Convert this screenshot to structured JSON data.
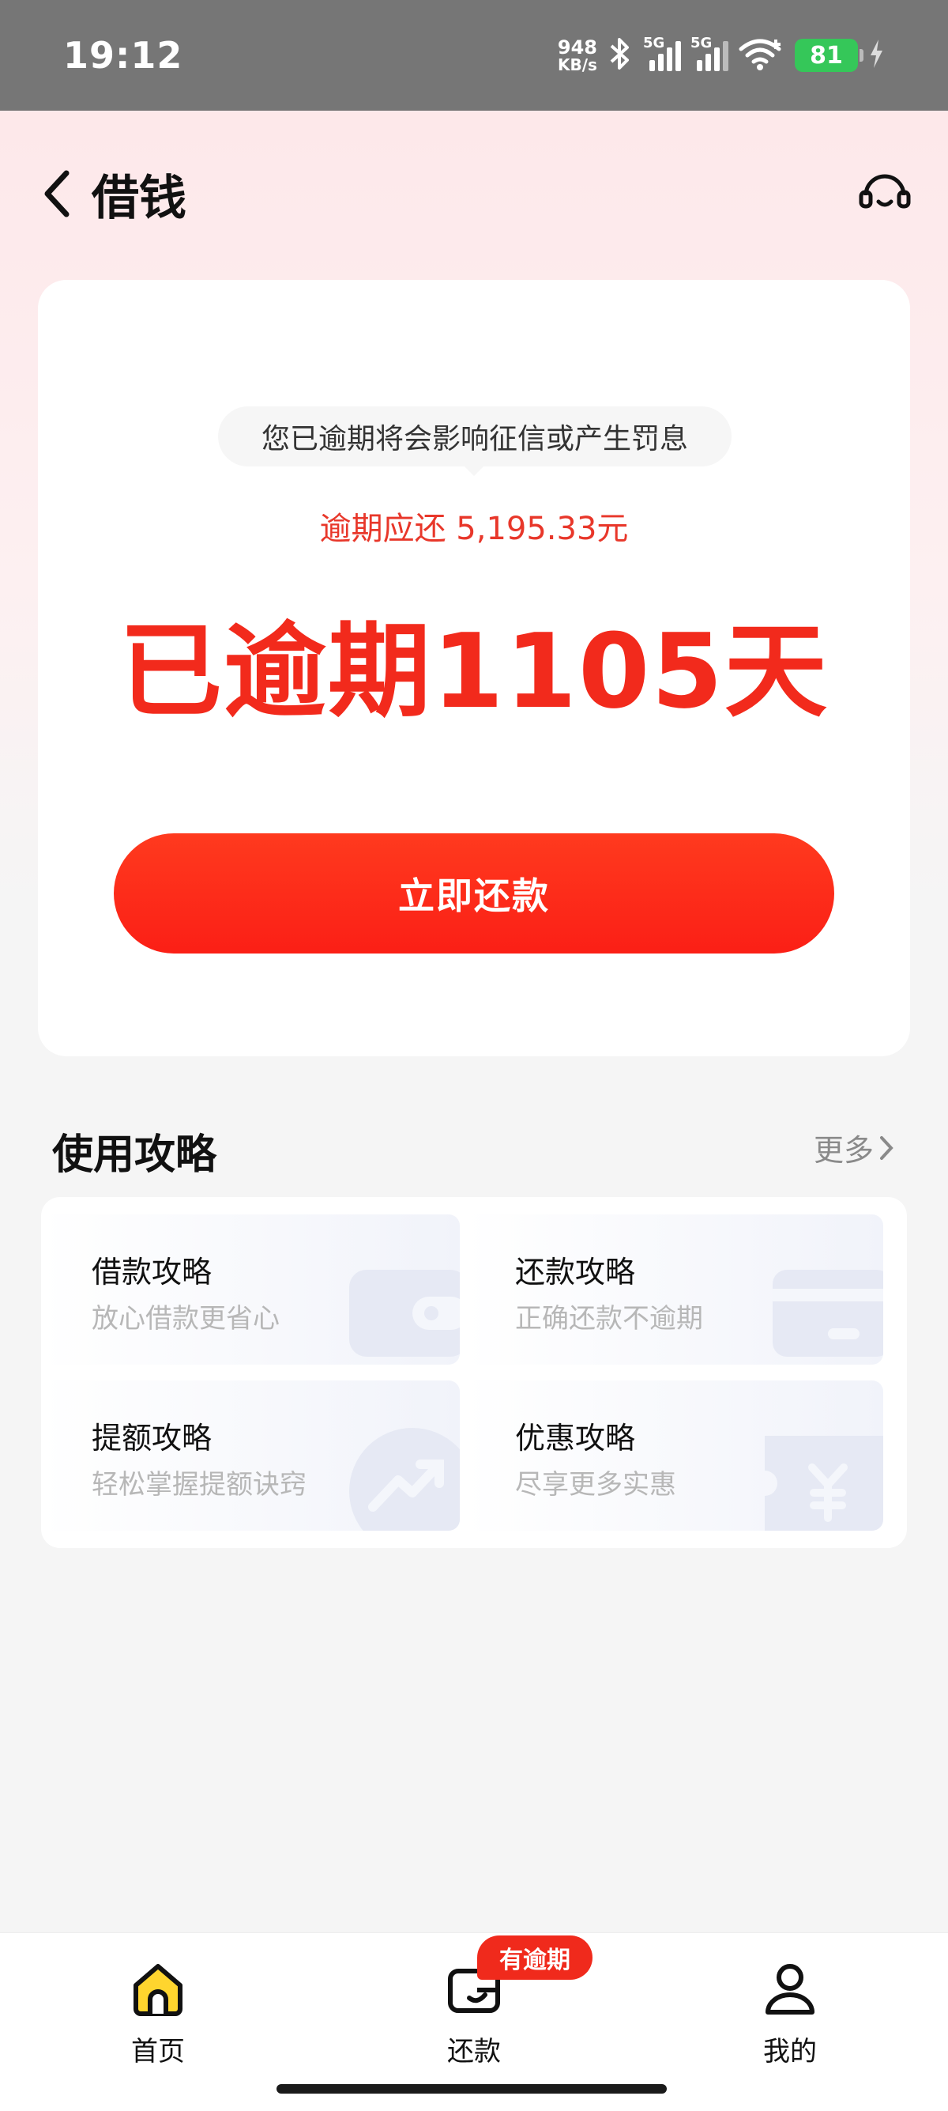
{
  "status_bar": {
    "time": "19:12",
    "net_speed_value": "948",
    "net_speed_unit": "KB/s",
    "sim1_label": "5G",
    "sim2_label": "5G",
    "battery_level": "81"
  },
  "header": {
    "title": "借钱"
  },
  "overdue_card": {
    "notice": "您已逾期将会影响征信或产生罚息",
    "amount_label": "逾期应还 5,195.33元",
    "overdue_status": "已逾期1105天",
    "repay_button": "立即还款"
  },
  "guides": {
    "title": "使用攻略",
    "more_label": "更多",
    "items": [
      {
        "title": "借款攻略",
        "subtitle": "放心借款更省心",
        "icon": "wallet-icon"
      },
      {
        "title": "还款攻略",
        "subtitle": "正确还款不逾期",
        "icon": "card-icon"
      },
      {
        "title": "提额攻略",
        "subtitle": "轻松掌握提额诀窍",
        "icon": "trend-up-icon"
      },
      {
        "title": "优惠攻略",
        "subtitle": "尽享更多实惠",
        "icon": "coupon-yuan-icon"
      }
    ]
  },
  "bottom_nav": {
    "items": [
      {
        "label": "首页",
        "icon": "home-icon"
      },
      {
        "label": "还款",
        "icon": "repay-wallet-icon"
      },
      {
        "label": "我的",
        "icon": "profile-icon"
      }
    ],
    "badge": "有逾期"
  },
  "colors": {
    "accent_red": "#f22a1c",
    "home_yellow": "#ffd52e",
    "battery_green": "#35c759"
  }
}
